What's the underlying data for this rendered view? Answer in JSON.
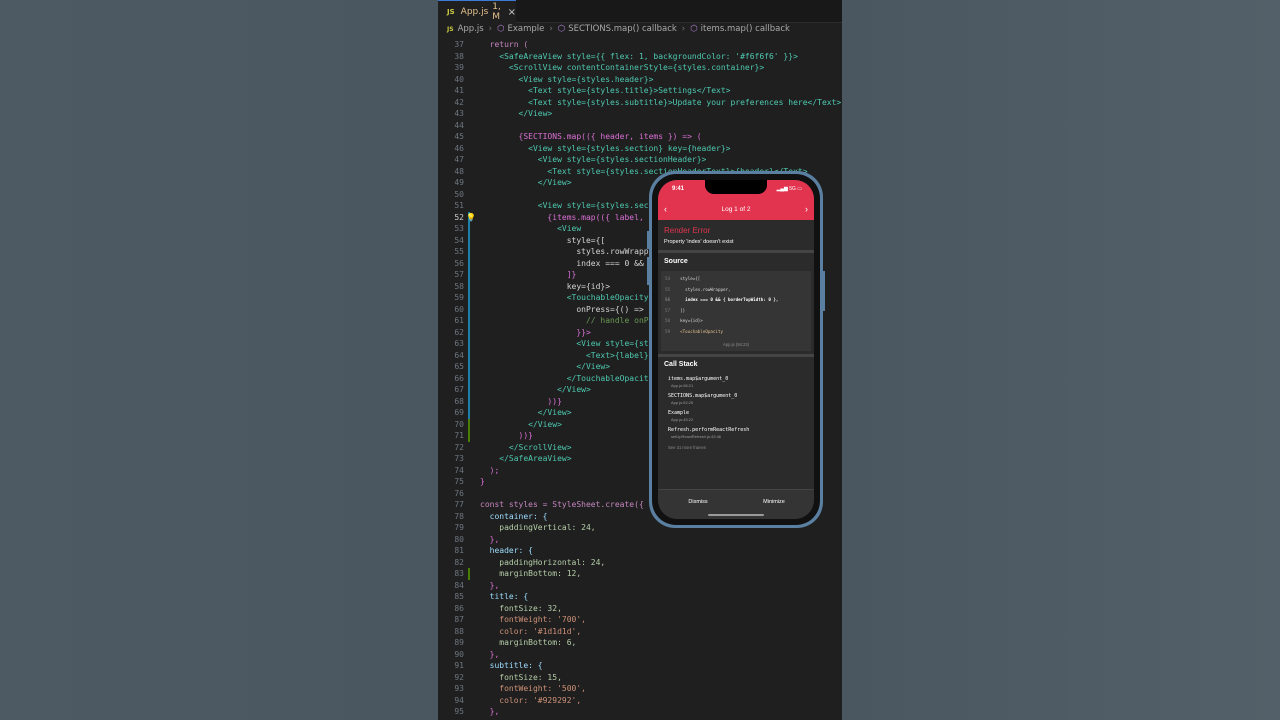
{
  "tab": {
    "lang_badge": "JS",
    "filename": "App.js",
    "status": "1, M",
    "close_glyph": "×"
  },
  "breadcrumb": [
    "App.js",
    "Example",
    "SECTIONS.map() callback",
    "items.map() callback"
  ],
  "code_lines": [
    {
      "n": "37",
      "t": "  return ("
    },
    {
      "n": "38",
      "t": "    <SafeAreaView style={{ flex: 1, backgroundColor: '#f6f6f6' }}>"
    },
    {
      "n": "39",
      "t": "      <ScrollView contentContainerStyle={styles.container}>"
    },
    {
      "n": "40",
      "t": "        <View style={styles.header}>"
    },
    {
      "n": "41",
      "t": "          <Text style={styles.title}>Settings</Text>"
    },
    {
      "n": "42",
      "t": "          <Text style={styles.subtitle}>Update your preferences here</Text>"
    },
    {
      "n": "43",
      "t": "        </View>"
    },
    {
      "n": "44",
      "t": ""
    },
    {
      "n": "45",
      "t": "        {SECTIONS.map(({ header, items }) => ("
    },
    {
      "n": "46",
      "t": "          <View style={styles.section} key={header}>"
    },
    {
      "n": "47",
      "t": "            <View style={styles.sectionHeader}>"
    },
    {
      "n": "48",
      "t": "              <Text style={styles.sectionHeaderText}>{header}</Text>"
    },
    {
      "n": "49",
      "t": "            </View>"
    },
    {
      "n": "50",
      "t": ""
    },
    {
      "n": "51",
      "t": "            <View style={styles.sectionBody}>"
    },
    {
      "n": "52",
      "t": "              {items.map(({ label, id }) => ("
    },
    {
      "n": "53",
      "t": "                <View"
    },
    {
      "n": "54",
      "t": "                  style={["
    },
    {
      "n": "55",
      "t": "                    styles.rowWrapper,"
    },
    {
      "n": "56",
      "t": "                    index === 0 && { borderTopWidth: 0 },"
    },
    {
      "n": "57",
      "t": "                  ]}"
    },
    {
      "n": "58",
      "t": "                  key={id}>"
    },
    {
      "n": "59",
      "t": "                  <TouchableOpacity"
    },
    {
      "n": "60",
      "t": "                    onPress={() => {"
    },
    {
      "n": "61",
      "t": "                      // handle onPress"
    },
    {
      "n": "62",
      "t": "                    }}>"
    },
    {
      "n": "63",
      "t": "                    <View style={styles.row}>"
    },
    {
      "n": "64",
      "t": "                      <Text>{label}</Text>"
    },
    {
      "n": "65",
      "t": "                    </View>"
    },
    {
      "n": "66",
      "t": "                  </TouchableOpacity>"
    },
    {
      "n": "67",
      "t": "                </View>"
    },
    {
      "n": "68",
      "t": "              ))}"
    },
    {
      "n": "69",
      "t": "            </View>"
    },
    {
      "n": "70",
      "t": "          </View>"
    },
    {
      "n": "71",
      "t": "        ))}"
    },
    {
      "n": "72",
      "t": "      </ScrollView>"
    },
    {
      "n": "73",
      "t": "    </SafeAreaView>"
    },
    {
      "n": "74",
      "t": "  );"
    },
    {
      "n": "75",
      "t": "}"
    },
    {
      "n": "76",
      "t": ""
    },
    {
      "n": "77",
      "t": "const styles = StyleSheet.create({"
    },
    {
      "n": "78",
      "t": "  container: {"
    },
    {
      "n": "79",
      "t": "    paddingVertical: 24,"
    },
    {
      "n": "80",
      "t": "  },"
    },
    {
      "n": "81",
      "t": "  header: {"
    },
    {
      "n": "82",
      "t": "    paddingHorizontal: 24,"
    },
    {
      "n": "83",
      "t": "    marginBottom: 12,"
    },
    {
      "n": "84",
      "t": "  },"
    },
    {
      "n": "85",
      "t": "  title: {"
    },
    {
      "n": "86",
      "t": "    fontSize: 32,"
    },
    {
      "n": "87",
      "t": "    fontWeight: '700',"
    },
    {
      "n": "88",
      "t": "    color: '#1d1d1d',"
    },
    {
      "n": "89",
      "t": "    marginBottom: 6,"
    },
    {
      "n": "90",
      "t": "  },"
    },
    {
      "n": "91",
      "t": "  subtitle: {"
    },
    {
      "n": "92",
      "t": "    fontSize: 15,"
    },
    {
      "n": "93",
      "t": "    fontWeight: '500',"
    },
    {
      "n": "94",
      "t": "    color: '#929292',"
    },
    {
      "n": "95",
      "t": "  },"
    }
  ],
  "current_line": "52",
  "lightbulb_icon": "lightbulb-icon",
  "phone": {
    "time": "9:41",
    "signal_text": "5G",
    "log_title": "Log 1 of 2",
    "prev_glyph": "‹",
    "next_glyph": "›",
    "error_title": "Render Error",
    "error_message": "Property 'index' doesn't exist",
    "source_heading": "Source",
    "source_lines": [
      {
        "n": "54",
        "t": "  style={["
      },
      {
        "n": "55",
        "t": "    styles.rowWrapper,"
      },
      {
        "n": "56",
        "t": "    index === 0 && { borderTopWidth: 0 },"
      },
      {
        "n": "57",
        "t": "  ]}"
      },
      {
        "n": "58",
        "t": "  key={id}>"
      },
      {
        "n": "59",
        "t": "  <TouchableOpacity"
      }
    ],
    "source_file": "App.js (56:23)",
    "callstack_heading": "Call Stack",
    "frames": [
      {
        "name": "items.map$argument_0",
        "loc": "App.js:56:21"
      },
      {
        "name": "SECTIONS.map$argument_0",
        "loc": "App.js:52:25"
      },
      {
        "name": "Example",
        "loc": "App.js:45:22"
      },
      {
        "name": "Refresh.performReactRefresh",
        "loc": "setUpReactRefresh.js:43:46"
      }
    ],
    "more_frames": "See 31 more frames",
    "dismiss": "Dismiss",
    "minimize": "Minimize"
  }
}
